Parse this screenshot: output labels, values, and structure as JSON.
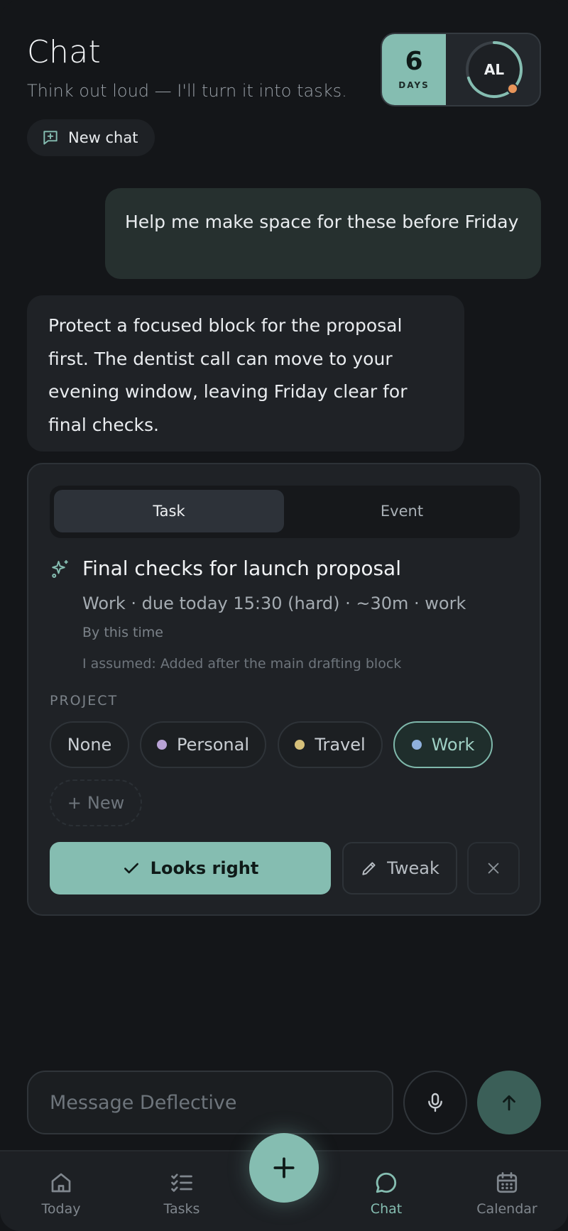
{
  "header": {
    "title": "Chat",
    "subtitle": "Think out loud — I'll turn it into tasks.",
    "new_chat_label": "New chat"
  },
  "streak": {
    "count": "6",
    "label": "DAYS"
  },
  "avatar": {
    "initials": "AL",
    "progress": 0.7,
    "status_color": "#e8955a"
  },
  "messages": [
    {
      "role": "user",
      "text": "Help me make space for these before Friday"
    },
    {
      "role": "assistant",
      "text": "Protect a focused block for the proposal first. The dentist call can move to your evening window, leaving Friday clear for final checks."
    }
  ],
  "proposal": {
    "tabs": [
      {
        "label": "Task",
        "selected": true
      },
      {
        "label": "Event",
        "selected": false
      }
    ],
    "title": "Final checks for launch proposal",
    "meta": "Work · due today 15:30 (hard) · ~30m · work",
    "deadline_hint": "By this time",
    "assumption": "I assumed: Added after the main drafting block",
    "project_label": "PROJECT",
    "projects": [
      {
        "label": "None",
        "color": ""
      },
      {
        "label": "Personal",
        "color": "#b9a3d6"
      },
      {
        "label": "Travel",
        "color": "#d6c07a"
      },
      {
        "label": "Work",
        "color": "#8fb0dc",
        "selected": true
      }
    ],
    "new_project_label": "New",
    "confirm_label": "Looks right",
    "tweak_label": "Tweak"
  },
  "composer": {
    "placeholder": "Message Deflective"
  },
  "nav": {
    "items": [
      {
        "label": "Today"
      },
      {
        "label": "Tasks"
      },
      {
        "label": "Chat",
        "active": true
      },
      {
        "label": "Calendar"
      }
    ]
  },
  "colors": {
    "accent": "#85bdb1",
    "background": "#141619",
    "card": "#1f2226"
  }
}
